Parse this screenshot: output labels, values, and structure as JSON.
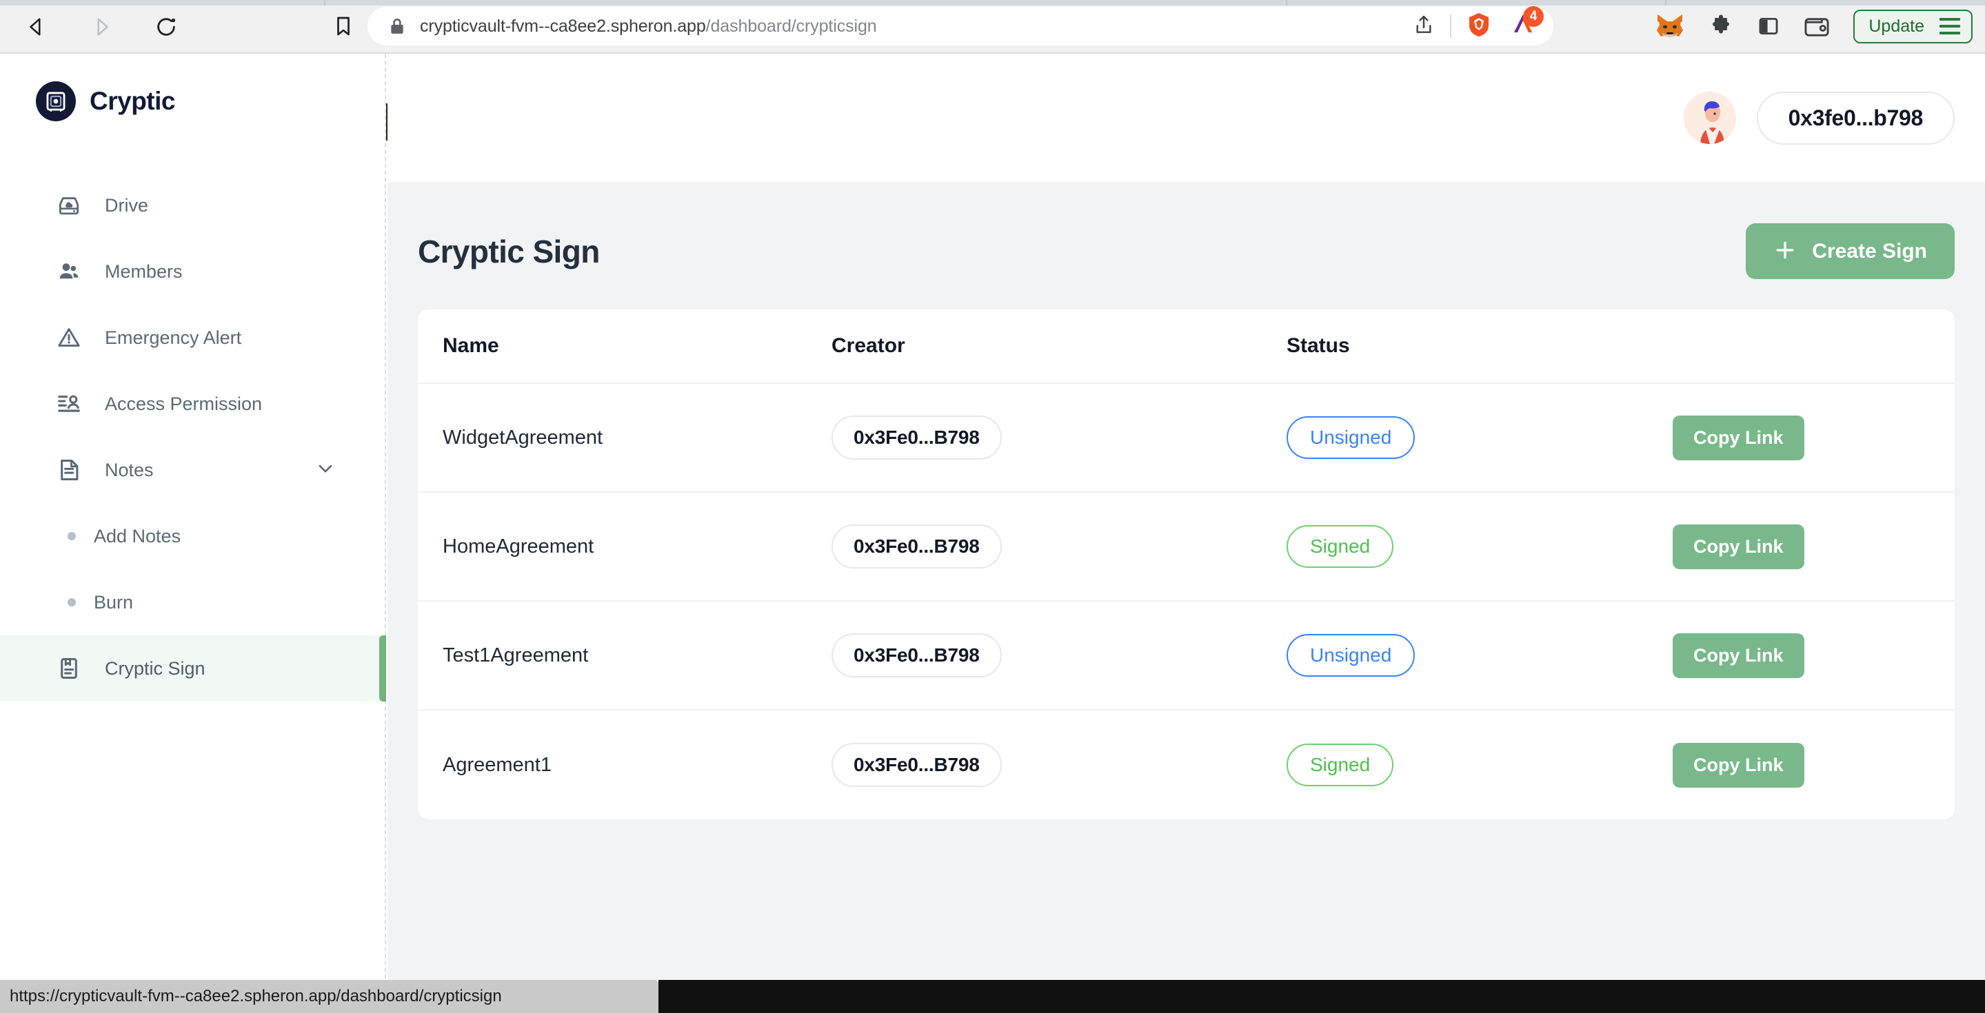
{
  "browser": {
    "back_icon": "back-arrow-icon",
    "forward_icon": "forward-arrow-icon",
    "reload_icon": "reload-icon",
    "bookmark_icon": "bookmark-icon",
    "lock_icon": "lock-icon",
    "url_main": "crypticvault-fvm--ca8ee2.spheron.app",
    "url_path": "/dashboard/crypticsign",
    "share_icon": "share-icon",
    "brave_shield_icon": "brave-shield-icon",
    "bat_rewards_icon": "bat-rewards-icon",
    "bat_badge_count": "4",
    "metamask_icon": "metamask-fox-icon",
    "extensions_icon": "puzzle-extensions-icon",
    "sidepanel_icon": "side-panel-icon",
    "wallet_icon": "brave-wallet-icon",
    "update_label": "Update",
    "menu_icon": "hamburger-menu-icon"
  },
  "status_bar": {
    "url": "https://crypticvault-fvm--ca8ee2.spheron.app/dashboard/crypticsign"
  },
  "sidebar": {
    "brand_name": "Cryptic",
    "brand_icon": "vault-safe-icon",
    "items": [
      {
        "label": "Drive",
        "icon": "drive-icon",
        "active": false
      },
      {
        "label": "Members",
        "icon": "members-people-icon",
        "active": false
      },
      {
        "label": "Emergency Alert",
        "icon": "warning-triangle-icon",
        "active": false
      },
      {
        "label": "Access Permission",
        "icon": "access-permission-icon",
        "active": false
      },
      {
        "label": "Notes",
        "icon": "notes-document-icon",
        "active": false,
        "expandable": true,
        "chevron": "chevron-down-icon"
      }
    ],
    "sub_items": [
      {
        "label": "Add Notes"
      },
      {
        "label": "Burn"
      }
    ],
    "active_item": {
      "label": "Cryptic Sign",
      "icon": "cryptic-sign-book-icon"
    }
  },
  "topbar": {
    "avatar_icon": "user-avatar-icon",
    "wallet_address": "0x3fe0...b798"
  },
  "main": {
    "page_title": "Cryptic Sign",
    "create_button": {
      "label": "Create Sign",
      "icon": "plus-icon"
    },
    "table": {
      "columns": [
        "Name",
        "Creator",
        "Status"
      ],
      "action_label": "Copy Link",
      "rows": [
        {
          "name": "WidgetAgreement",
          "creator": "0x3Fe0...B798",
          "status": "Unsigned",
          "status_kind": "unsigned",
          "action": "Copy Link"
        },
        {
          "name": "HomeAgreement",
          "creator": "0x3Fe0...B798",
          "status": "Signed",
          "status_kind": "signed",
          "action": "Copy Link"
        },
        {
          "name": "Test1Agreement",
          "creator": "0x3Fe0...B798",
          "status": "Unsigned",
          "status_kind": "unsigned",
          "action": "Copy Link"
        },
        {
          "name": "Agreement1",
          "creator": "0x3Fe0...B798",
          "status": "Signed",
          "status_kind": "signed",
          "action": "Copy Link"
        }
      ]
    }
  },
  "colors": {
    "accent_green": "#79b88a",
    "active_nav_bg": "#f2f8f3",
    "active_bar": "#73b37e",
    "unsigned_blue": "#3b82f6",
    "signed_green": "#4cc14c",
    "brand_dark": "#131a35",
    "page_bg": "#f1f3f5"
  }
}
